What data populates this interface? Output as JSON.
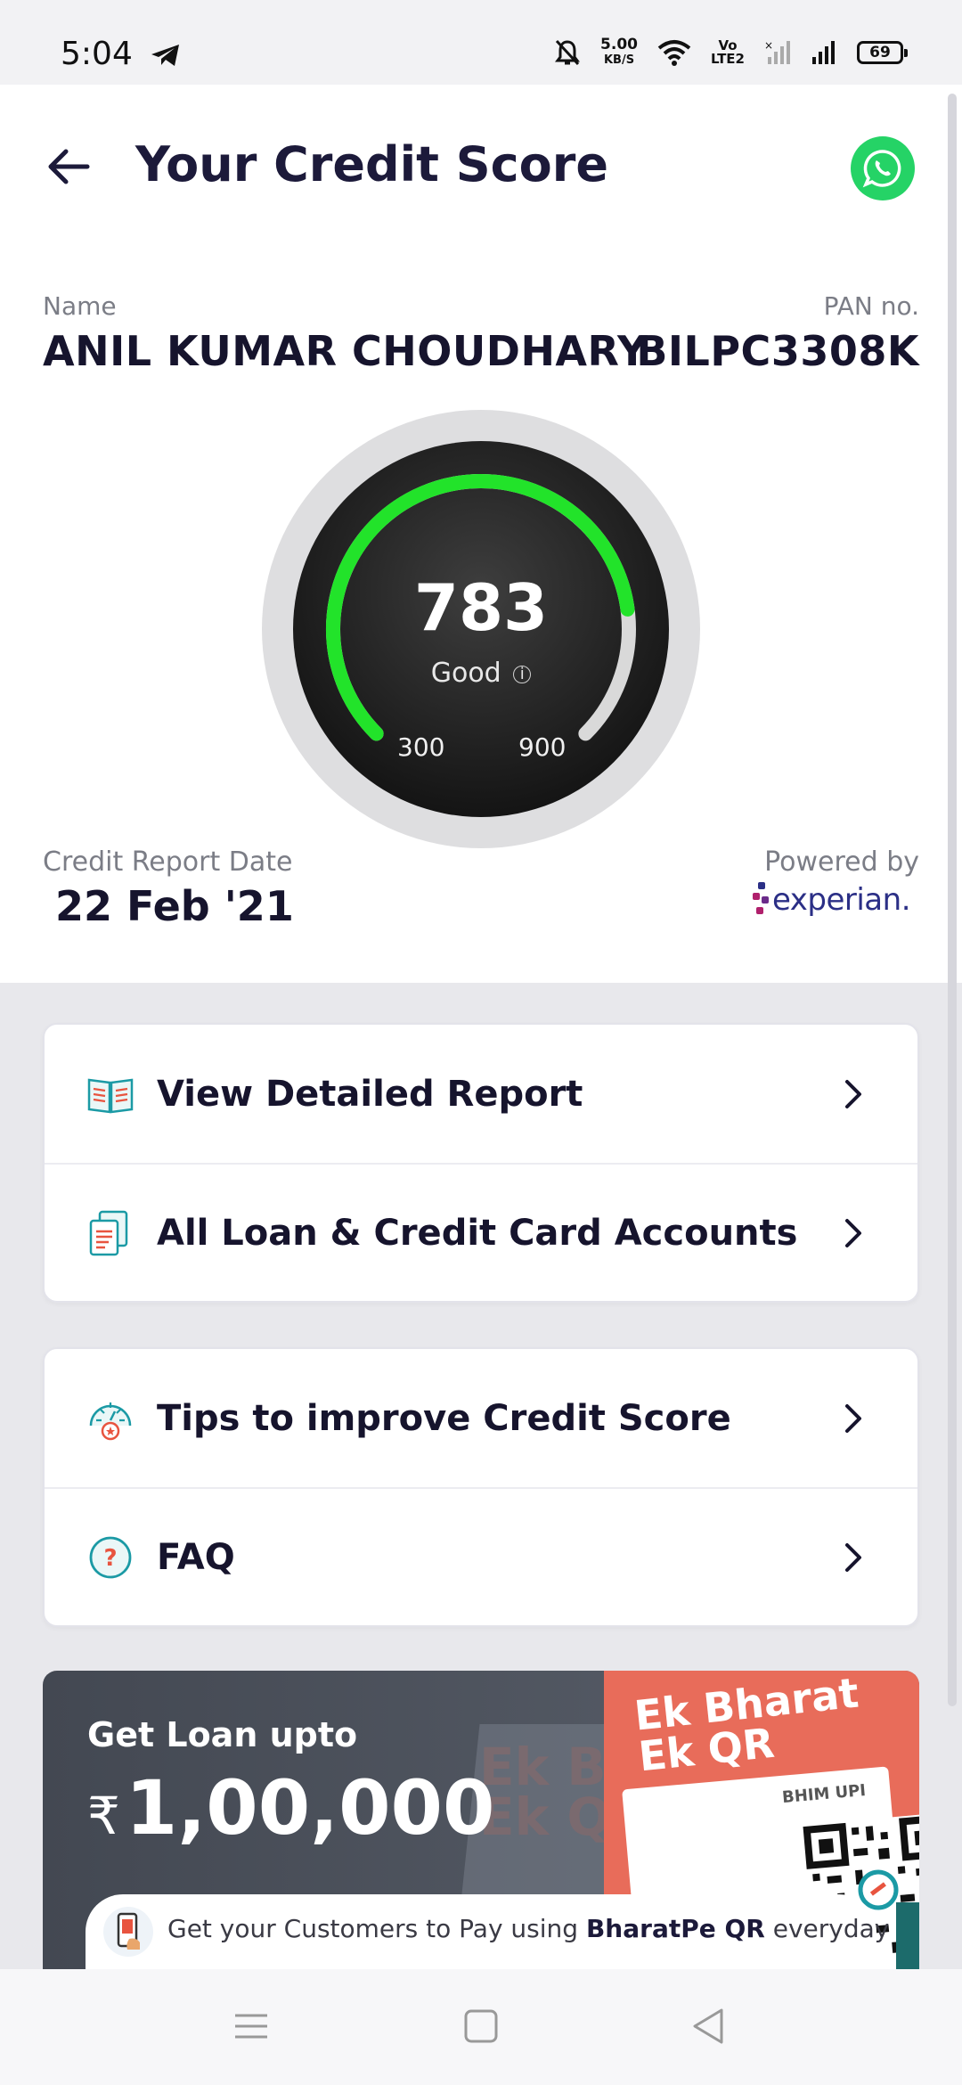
{
  "status_bar": {
    "time": "5:04",
    "net_speed": "5.00",
    "net_unit": "KB/S",
    "volte": "Vo",
    "lte": "LTE2",
    "battery": "69"
  },
  "header": {
    "title": "Your Credit Score"
  },
  "profile": {
    "name_label": "Name",
    "name_value": "ANIL KUMAR CHOUDHARY",
    "pan_label": "PAN no.",
    "pan_value": "BILPC3308K"
  },
  "score": {
    "value": "783",
    "rating": "Good",
    "info_symbol": "i",
    "min": "300",
    "max": "900",
    "range_min": 300,
    "range_max": 900,
    "score_number": 783
  },
  "report": {
    "date_label": "Credit Report Date",
    "date_value": "22 Feb '21",
    "powered_label": "Powered by",
    "provider": "experian."
  },
  "menu": {
    "group1": [
      {
        "label": "View Detailed Report",
        "icon": "book-icon"
      },
      {
        "label": "All Loan & Credit Card Accounts",
        "icon": "documents-icon"
      }
    ],
    "group2": [
      {
        "label": "Tips to improve Credit Score",
        "icon": "meter-icon"
      },
      {
        "label": "FAQ",
        "icon": "question-icon"
      }
    ]
  },
  "banner": {
    "line1": "Get Loan upto",
    "currency": "₹",
    "amount": "1,00,000",
    "qr_title_1": "Ek Bharat",
    "qr_title_2": "Ek QR",
    "ghost_1": "Ek Bha",
    "ghost_2": "Ek QR",
    "upi": "BHIM UPI",
    "strip_prefix": "Get your Customers to Pay using ",
    "strip_bold": "BharatPe QR",
    "strip_suffix": " everyday"
  },
  "colors": {
    "accent": "#1c1a3a",
    "gauge_green": "#22e32a",
    "whatsapp": "#25d366",
    "banner_red": "#e86c5a"
  }
}
